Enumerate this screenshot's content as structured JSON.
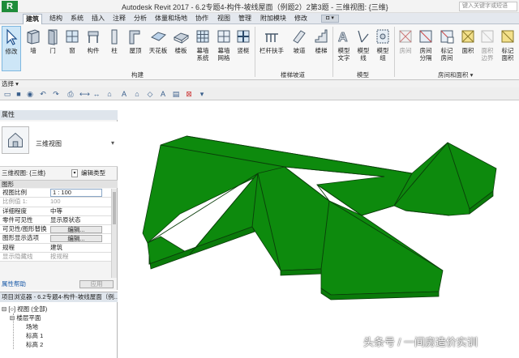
{
  "window": {
    "app_logo": "R",
    "title": "Autodesk Revit 2017 -   6.2专题4-构件-坡线屋面（例题2）2第3题 - 三维视图: {三维}",
    "help_search_placeholder": "键入关键字或短语"
  },
  "ribbon_tabs": [
    "建筑",
    "结构",
    "系统",
    "插入",
    "注释",
    "分析",
    "体量和场地",
    "协作",
    "视图",
    "管理",
    "附加模块",
    "修改"
  ],
  "ribbon_tab_extra": "◘ ▾",
  "ribbon": {
    "buttons": [
      {
        "label": "修改",
        "icon": "cursor-icon"
      },
      {
        "label": "墙",
        "icon": "wall-icon"
      },
      {
        "label": "门",
        "icon": "door-icon"
      },
      {
        "label": "窗",
        "icon": "window-icon"
      },
      {
        "label": "构件",
        "icon": "component-icon"
      },
      {
        "label": "柱",
        "icon": "column-icon"
      },
      {
        "label": "屋顶",
        "icon": "roof-icon"
      },
      {
        "label": "天花板",
        "icon": "ceiling-icon"
      },
      {
        "label": "楼板",
        "icon": "floor-icon"
      },
      {
        "label": "幕墙\n系统",
        "icon": "curtain-system-icon"
      },
      {
        "label": "幕墙\n网格",
        "icon": "curtain-grid-icon"
      },
      {
        "label": "竖梃",
        "icon": "mullion-icon"
      },
      {
        "label": "栏杆扶手",
        "icon": "railing-icon"
      },
      {
        "label": "坡道",
        "icon": "ramp-icon"
      },
      {
        "label": "楼梯",
        "icon": "stair-icon"
      },
      {
        "label": "模型\n文字",
        "icon": "model-text-icon"
      },
      {
        "label": "模型\n线",
        "icon": "model-line-icon"
      },
      {
        "label": "模型\n组",
        "icon": "model-group-icon"
      },
      {
        "label": "房间",
        "icon": "room-icon"
      },
      {
        "label": "房间\n分隔",
        "icon": "room-separator-icon"
      },
      {
        "label": "标记\n房间",
        "icon": "tag-room-icon"
      },
      {
        "label": "面积",
        "icon": "area-icon"
      },
      {
        "label": "面积\n边界",
        "icon": "area-boundary-icon"
      },
      {
        "label": "标记\n面积",
        "icon": "tag-area-icon"
      }
    ],
    "panels": [
      "选择 ▾",
      "构建",
      "楼梯坡道",
      "模型",
      "房间和面积 ▾"
    ]
  },
  "properties": {
    "title": "属性",
    "type_name": "三维视图",
    "selector": "三维视图: {三维}",
    "edit_type": "编辑类型",
    "group": "图形",
    "rows": [
      {
        "key": "视图比例",
        "value": "1 : 100",
        "kind": "boxed"
      },
      {
        "key": "比例值 1:",
        "value": "100",
        "kind": "gray"
      },
      {
        "key": "详细程度",
        "value": "中等",
        "kind": "text"
      },
      {
        "key": "零件可见性",
        "value": "显示原状态",
        "kind": "text"
      },
      {
        "key": "可见性/图形替换",
        "value": "编辑...",
        "kind": "button"
      },
      {
        "key": "图形显示选项",
        "value": "编辑...",
        "kind": "button"
      },
      {
        "key": "规程",
        "value": "建筑",
        "kind": "text"
      },
      {
        "key": "显示隐藏线",
        "value": "按规程",
        "kind": "gray"
      }
    ],
    "help": "属性帮助",
    "apply": "应用"
  },
  "browser": {
    "title": "项目浏览器 - 6.2专题4-构件-坡线屋面（例...",
    "items": [
      {
        "label": "⊟ [○] 视图 (全部)",
        "level": 0
      },
      {
        "label": "⊟ 楼层平面",
        "level": 1
      },
      {
        "label": "场地",
        "level": 2
      },
      {
        "label": "标高 1",
        "level": 2
      },
      {
        "label": "标高 2",
        "level": 2
      }
    ]
  },
  "canvas": {
    "roof_color": "#0d8a0d",
    "edge_color": "#0a3d0a"
  },
  "watermark": "头条号 / 一间房造价实训"
}
